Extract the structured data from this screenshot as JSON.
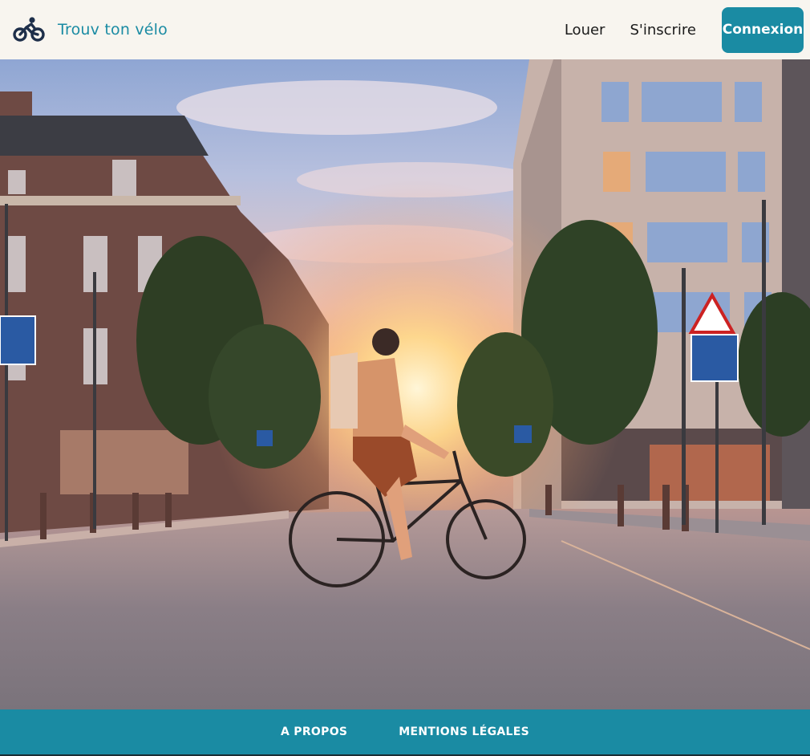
{
  "brand": {
    "name": "Trouv ton vélo",
    "logo_icon": "bicycle-icon",
    "color": "#1a8ba3"
  },
  "nav": {
    "links": [
      "Louer",
      "S'inscrire"
    ],
    "login_label": "Connexion"
  },
  "hero": {
    "image_alt": ""
  },
  "footer": {
    "links": [
      "A PROPOS",
      "MENTIONS LÉGALES"
    ]
  },
  "colors": {
    "accent": "#1a8ba3",
    "background": "#f8f5ef"
  }
}
